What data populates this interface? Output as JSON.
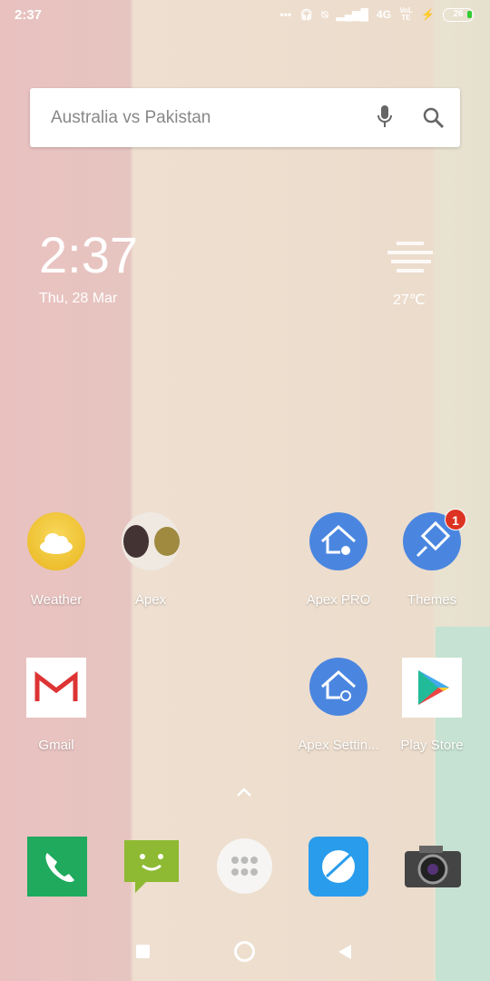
{
  "status": {
    "time": "2:37",
    "network": "4G",
    "volte": "VoLTE",
    "battery": "26"
  },
  "search": {
    "query": "Australia vs Pakistan"
  },
  "clock": {
    "time": "2:37",
    "date": "Thu, 28 Mar"
  },
  "weather": {
    "temp": "27℃",
    "icon": "fog-icon"
  },
  "apps": [
    {
      "label": "Weather"
    },
    {
      "label": "Apex"
    },
    {
      "label": "Apex PRO"
    },
    {
      "label": "Themes",
      "badge": "1"
    },
    {
      "label": "Gmail"
    },
    {
      "label": "Apex Settin..."
    },
    {
      "label": "Play Store"
    }
  ],
  "dock": [
    "phone",
    "messages",
    "app-drawer",
    "browser",
    "camera"
  ],
  "colors": {
    "accent": "#4a86e0",
    "badge": "#dd3322"
  }
}
